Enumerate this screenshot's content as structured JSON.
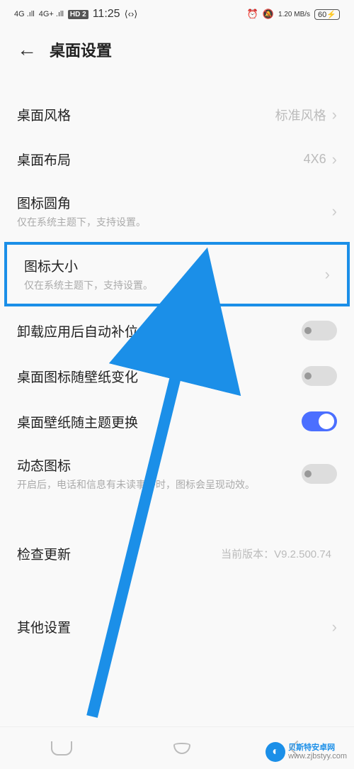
{
  "status_bar": {
    "signal1": "4G",
    "signal2": "4G+",
    "hd": "HD 2",
    "time": "11:25",
    "speed": "1.20 MB/s",
    "battery": "60"
  },
  "header": {
    "title": "桌面设置"
  },
  "rows": {
    "style": {
      "label": "桌面风格",
      "value": "标准风格"
    },
    "layout": {
      "label": "桌面布局",
      "value": "4X6"
    },
    "corner": {
      "label": "图标圆角",
      "sub": "仅在系统主题下，支持设置。"
    },
    "size": {
      "label": "图标大小",
      "sub": "仅在系统主题下，支持设置。"
    },
    "autofill": {
      "label": "卸载应用后自动补位"
    },
    "wallpaper_icon": {
      "label": "桌面图标随壁纸变化"
    },
    "theme_wallpaper": {
      "label": "桌面壁纸随主题更换"
    },
    "dynamic": {
      "label": "动态图标",
      "sub": "开启后，电话和信息有未读事件时，图标会呈现动效。"
    },
    "update": {
      "label": "检查更新",
      "value": "当前版本：V9.2.500.74"
    },
    "other": {
      "label": "其他设置"
    }
  },
  "watermark": {
    "name": "贝斯特安卓网",
    "url": "www.zjbstyy.com"
  }
}
